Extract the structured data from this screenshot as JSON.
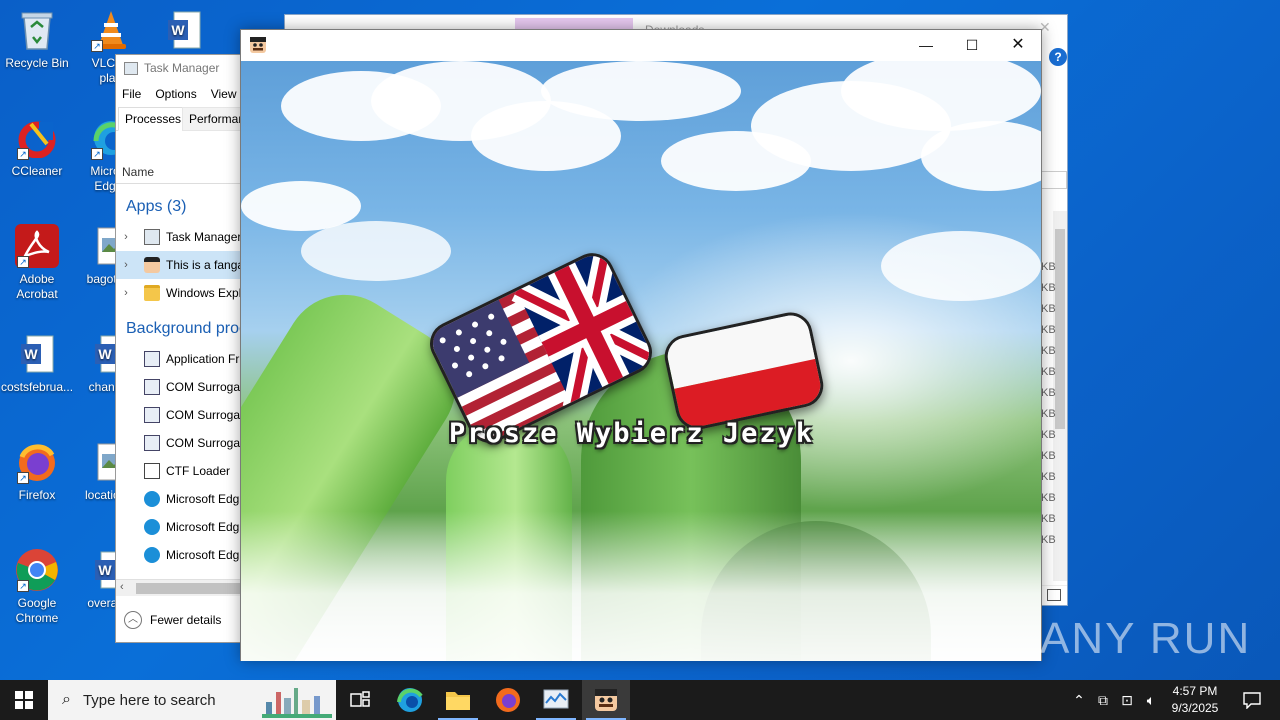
{
  "desktop": {
    "icons": [
      {
        "label": "Recycle Bin"
      },
      {
        "label": "VLC m... play..."
      },
      {
        "label": "CCleaner"
      },
      {
        "label": "Micro... Edg..."
      },
      {
        "label": "Adobe Acrobat"
      },
      {
        "label": "bagoth..."
      },
      {
        "label": "costsfebrua..."
      },
      {
        "label": "chang..."
      },
      {
        "label": "Firefox"
      },
      {
        "label": "location..."
      },
      {
        "label": "Google Chrome"
      },
      {
        "label": "overall..."
      }
    ]
  },
  "explorer": {
    "title": "Downloads",
    "kb_labels": [
      "KB",
      "KB",
      "KB",
      "KB",
      "KB",
      "KB",
      "KB",
      "KB",
      "KB",
      "KB",
      "KB",
      "KB",
      "KB",
      "KB"
    ]
  },
  "task_manager": {
    "title": "Task Manager",
    "menu": [
      "File",
      "Options",
      "View"
    ],
    "tabs": [
      "Processes",
      "Performar"
    ],
    "column_name": "Name",
    "apps_group": "Apps (3)",
    "apps": [
      "Task Manager",
      "This is a fanga",
      "Windows Expl"
    ],
    "background_group": "Background proc",
    "background": [
      "Application Fr",
      "COM Surrogat",
      "COM Surrogat",
      "COM Surrogat",
      "CTF Loader",
      "Microsoft Edg",
      "Microsoft Edg",
      "Microsoft Edg"
    ],
    "fewer_details": "Fewer details"
  },
  "game": {
    "prompt": "Prosze Wybierz Jezyk",
    "languages": [
      "english-flag",
      "polish-flag"
    ]
  },
  "watermark": "ANY RUN",
  "taskbar": {
    "search_placeholder": "Type here to search",
    "time": "4:57 PM",
    "date": "9/3/2025"
  },
  "colors": {
    "desktop_blue": "#0a64cc",
    "taskbar": "#1b1b1b",
    "tm_group_blue": "#1a5fb4"
  }
}
